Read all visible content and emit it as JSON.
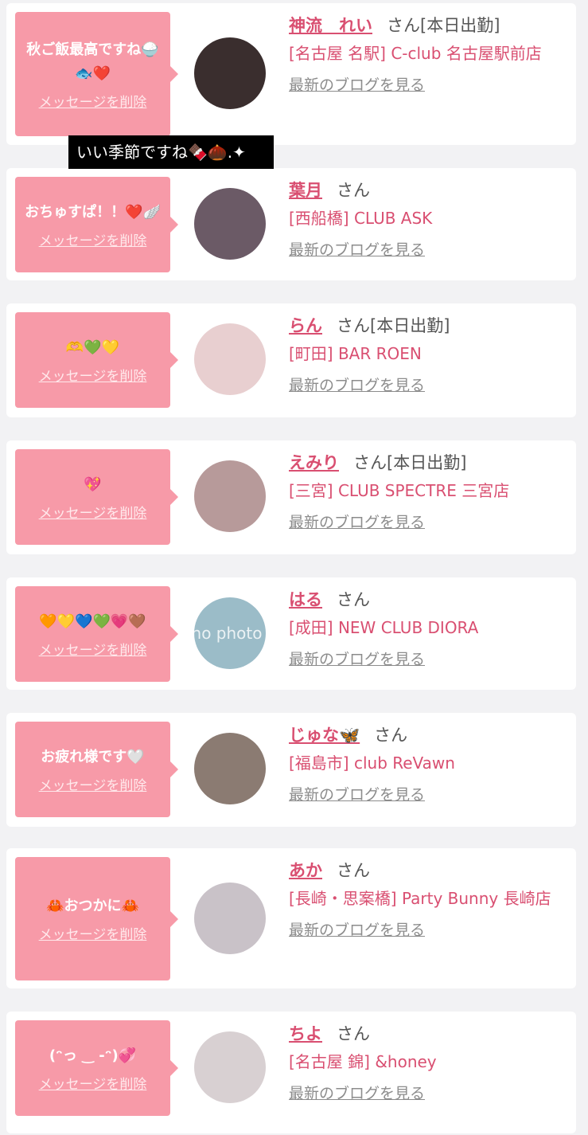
{
  "delete_label": "メッセージを削除",
  "blog_label": "最新のブログを見る",
  "tooltip": "いい季節ですね🍫🌰.✦",
  "items": [
    {
      "message": "秋ご飯最高ですね🍚🐟❤️",
      "name": "神流　れい",
      "san": "さん",
      "shift": "[本日出勤]",
      "shop": "[名古屋 名駅] C-club 名古屋駅前店",
      "avatar_color": "#3a2e2e"
    },
    {
      "message": "おちゅすぱ！！❤️🪽",
      "name": "葉月",
      "san": "さん",
      "shift": "",
      "shop": "[西船橋] CLUB ASK",
      "avatar_color": "#6b5a66"
    },
    {
      "message": "🫶💚💛",
      "name": "らん",
      "san": "さん",
      "shift": "[本日出勤]",
      "shop": "[町田] BAR ROEN",
      "avatar_color": "#e8cfd0"
    },
    {
      "message": "💖",
      "name": "えみり",
      "san": "さん",
      "shift": "[本日出勤]",
      "shop": "[三宮] CLUB SPECTRE 三宮店",
      "avatar_color": "#b79a9a"
    },
    {
      "message": "🧡💛💙💚💗🤎",
      "name": "はる",
      "san": "さん",
      "shift": "",
      "shop": "[成田] NEW CLUB DIORA",
      "avatar_color": "#9bbcc8",
      "avatar_text": "no photo"
    },
    {
      "message": "お疲れ様です🤍",
      "name": "じゅな🦋",
      "san": "さん",
      "shift": "",
      "shop": "[福島市] club ReVawn",
      "avatar_color": "#8b7b72"
    },
    {
      "message": "🦀おつかに🦀",
      "name": "あか",
      "san": "さん",
      "shift": "",
      "shop": "[長崎・思案橋] Party Bunny 長崎店",
      "avatar_color": "#c9c2c8"
    },
    {
      "message": "(ᵔっ ‿ -ᵔ)💞",
      "name": "ちよ",
      "san": "さん",
      "shift": "",
      "shop": "[名古屋 錦] &honey",
      "avatar_color": "#d8d0d2"
    }
  ]
}
